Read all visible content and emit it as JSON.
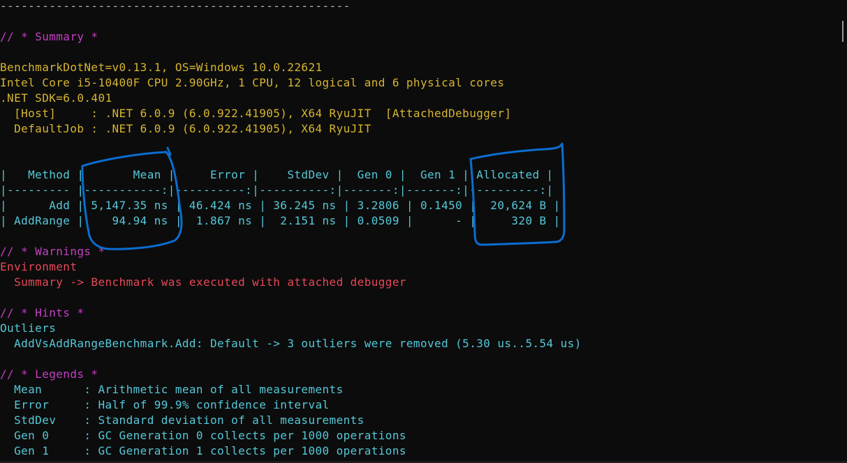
{
  "separator": "--------------------------------------------------",
  "summary_header": "// * Summary *",
  "env": {
    "line1": "BenchmarkDotNet=v0.13.1, OS=Windows 10.0.22621",
    "line2": "Intel Core i5-10400F CPU 2.90GHz, 1 CPU, 12 logical and 6 physical cores",
    "line3": ".NET SDK=6.0.401",
    "line4": "  [Host]     : .NET 6.0.9 (6.0.922.41905), X64 RyuJIT  [AttachedDebugger]",
    "line5": "  DefaultJob : .NET 6.0.9 (6.0.922.41905), X64 RyuJIT"
  },
  "table": {
    "header": "|   Method |       Mean |     Error |    StdDev |  Gen 0 |  Gen 1 | Allocated |",
    "divider": "|--------- |-----------:|----------:|----------:|-------:|-------:|----------:|",
    "rows": [
      "|      Add | 5,147.35 ns | 46.424 ns | 36.245 ns | 3.2806 | 0.1450 |  20,624 B |",
      "| AddRange |    94.94 ns |  1.867 ns |  2.151 ns | 0.0509 |      - |     320 B |"
    ]
  },
  "warnings": {
    "header": "// * Warnings *",
    "category": "Environment",
    "message": "  Summary -> Benchmark was executed with attached debugger"
  },
  "hints": {
    "header": "// * Hints *",
    "category": "Outliers",
    "message": "  AddVsAddRangeBenchmark.Add: Default -> 3 outliers were removed (5.30 us..5.54 us)"
  },
  "legends": {
    "header": "// * Legends *",
    "items": [
      "  Mean      : Arithmetic mean of all measurements",
      "  Error     : Half of 99.9% confidence interval",
      "  StdDev    : Standard deviation of all measurements",
      "  Gen 0     : GC Generation 0 collects per 1000 operations",
      "  Gen 1     : GC Generation 1 collects per 1000 operations"
    ]
  },
  "colors": {
    "background": "#0c0c0c",
    "comment": "#c43fc4",
    "env_text": "#d7b531",
    "table_text": "#56c8d8",
    "warning_text": "#e74856",
    "annotation": "#0a6ed1"
  }
}
